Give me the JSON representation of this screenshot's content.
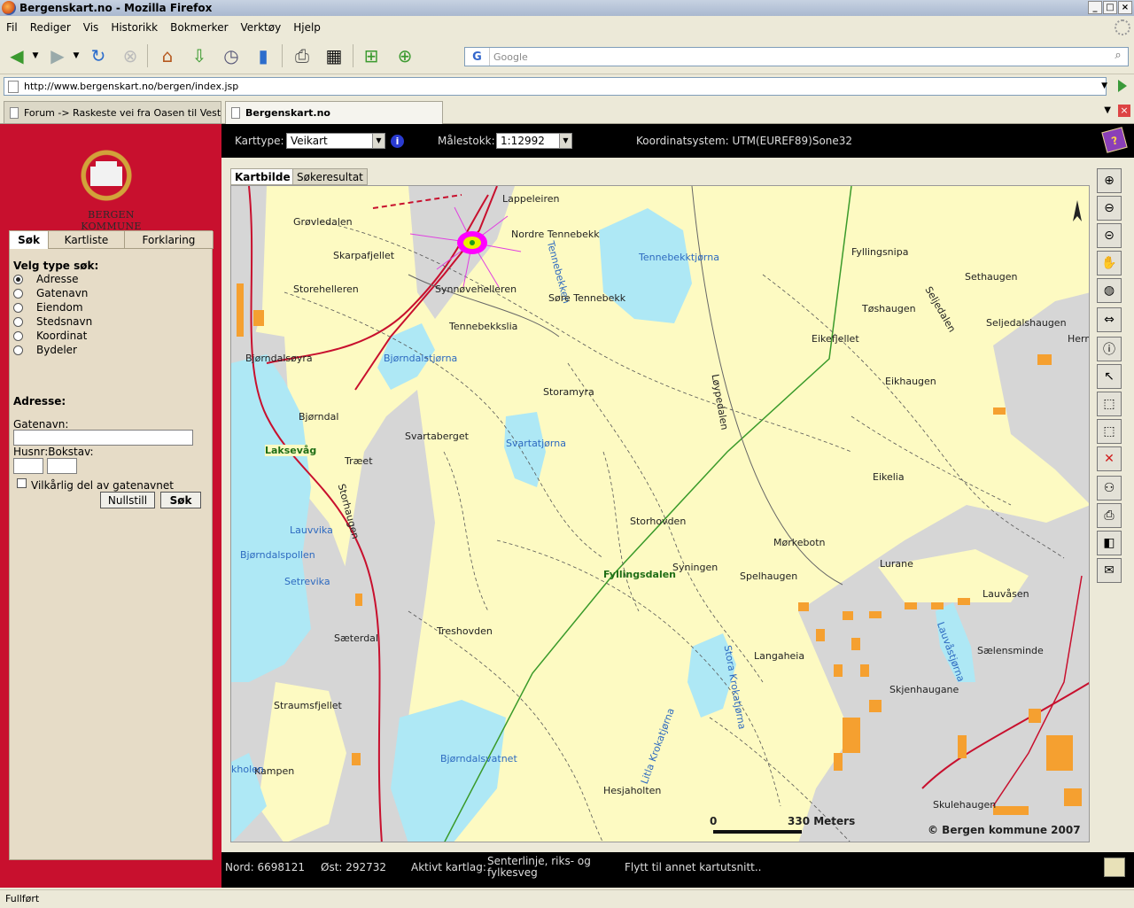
{
  "window": {
    "title": "Bergenskart.no - Mozilla Firefox"
  },
  "menu": [
    "Fil",
    "Rediger",
    "Vis",
    "Historikk",
    "Bokmerker",
    "Verktøy",
    "Hjelp"
  ],
  "search": {
    "placeholder": "Google",
    "engine": "G"
  },
  "url": "http://www.bergenskart.no/bergen/index.jsp",
  "tabs": [
    {
      "label": "Forum -> Raskeste vei fra Oasen til Vestk..."
    },
    {
      "label": "Bergenskart.no"
    }
  ],
  "logo": {
    "text": "BERGEN KOMMUNE"
  },
  "left": {
    "tabs": [
      "Søk",
      "Kartliste",
      "Forklaring"
    ],
    "search_type_title": "Velg type søk:",
    "search_types": [
      "Adresse",
      "Gatenavn",
      "Eiendom",
      "Stedsnavn",
      "Koordinat",
      "Bydeler"
    ],
    "selected_type": "Adresse",
    "address_title": "Adresse:",
    "street_label": "Gatenavn:",
    "house_label": "Husnr:Bokstav:",
    "checkbox_label": "Vilkårlig del av gatenavnet",
    "reset_button": "Nullstill",
    "search_button": "Søk"
  },
  "topbar": {
    "maptype_label": "Karttype:",
    "maptype_value": "Veikart",
    "scale_label": "Målestokk:",
    "scale_value": "1:12992",
    "coord_system": "Koordinatsystem: UTM(EUREF89)Sone32"
  },
  "map": {
    "tabs": [
      "Kartbilde",
      "Søkeresultat"
    ],
    "scale_zero": "0",
    "scale_text": "330 Meters",
    "copyright": "© Bergen kommune 2007",
    "labels": [
      {
        "text": "Lappeleiren",
        "style": ""
      },
      {
        "text": "Grøvledalen",
        "style": ""
      },
      {
        "text": "Nordre Tennebekk",
        "style": ""
      },
      {
        "text": "Tennebekken",
        "style": "blue"
      },
      {
        "text": "Tennebekktjørna",
        "style": "blue"
      },
      {
        "text": "Skarpafjellet",
        "style": ""
      },
      {
        "text": "Storehelleren",
        "style": ""
      },
      {
        "text": "Synnøvehelleren",
        "style": ""
      },
      {
        "text": "Søre Tennebekk",
        "style": ""
      },
      {
        "text": "Tennebekkslia",
        "style": ""
      },
      {
        "text": "Fyllingsnipa",
        "style": ""
      },
      {
        "text": "Sethaugen",
        "style": ""
      },
      {
        "text": "Seljedalen",
        "style": ""
      },
      {
        "text": "Tøshaugen",
        "style": ""
      },
      {
        "text": "Seljedalshaugen",
        "style": ""
      },
      {
        "text": "Herm",
        "style": ""
      },
      {
        "text": "Eikefjellet",
        "style": ""
      },
      {
        "text": "Bjørndalsøyra",
        "style": ""
      },
      {
        "text": "Bjørndalstjørna",
        "style": "blue"
      },
      {
        "text": "Storamyra",
        "style": ""
      },
      {
        "text": "Løypedalen",
        "style": ""
      },
      {
        "text": "Eikhaugen",
        "style": ""
      },
      {
        "text": "Bjørndal",
        "style": ""
      },
      {
        "text": "Svartaberget",
        "style": ""
      },
      {
        "text": "Svartatjørna",
        "style": "blue"
      },
      {
        "text": "Laksevåg",
        "style": "green"
      },
      {
        "text": "Træet",
        "style": ""
      },
      {
        "text": "Storhaugen",
        "style": ""
      },
      {
        "text": "Eikelia",
        "style": ""
      },
      {
        "text": "Storhovden",
        "style": ""
      },
      {
        "text": "Lauvvika",
        "style": "blue"
      },
      {
        "text": "Bjørndalspollen",
        "style": "blue"
      },
      {
        "text": "Mørkebotn",
        "style": ""
      },
      {
        "text": "Syningen",
        "style": ""
      },
      {
        "text": "Lurane",
        "style": ""
      },
      {
        "text": "Fyllingsdalen",
        "style": "green"
      },
      {
        "text": "Spelhaugen",
        "style": ""
      },
      {
        "text": "Setrevika",
        "style": "blue"
      },
      {
        "text": "Lauvåsen",
        "style": ""
      },
      {
        "text": "Treshovden",
        "style": ""
      },
      {
        "text": "Sæterdal",
        "style": ""
      },
      {
        "text": "Lauvåstjørna",
        "style": "blue"
      },
      {
        "text": "Stora Krokatjørna",
        "style": "blue"
      },
      {
        "text": "Sælensminde",
        "style": ""
      },
      {
        "text": "Langaheia",
        "style": ""
      },
      {
        "text": "Skjenhaugane",
        "style": ""
      },
      {
        "text": "Straumsfjellet",
        "style": ""
      },
      {
        "text": "Litla Krokatjørna",
        "style": "blue"
      },
      {
        "text": "Bjørndalsvatnet",
        "style": "blue"
      },
      {
        "text": "Kampen",
        "style": ""
      },
      {
        "text": "Hesjaholten",
        "style": ""
      },
      {
        "text": "Skulehaugen",
        "style": ""
      },
      {
        "text": "kholen",
        "style": "blue"
      }
    ]
  },
  "bottombar": {
    "nord": "Nord: 6698121",
    "ost": "Øst: 292732",
    "active_layer_label": "Aktivt kartlag:",
    "active_layer_value": "Senterlinje, riks- og fylkesveg",
    "status": "Flytt til annet kartutsnitt.."
  },
  "statusbar": "Fullført",
  "icons": [
    "back-icon",
    "forward-icon",
    "reload-icon",
    "stop-icon",
    "home-icon",
    "download-icon",
    "history-icon",
    "bookmark-icon",
    "print-icon",
    "screen-icon",
    "newtab-icon",
    "addtab-icon"
  ]
}
